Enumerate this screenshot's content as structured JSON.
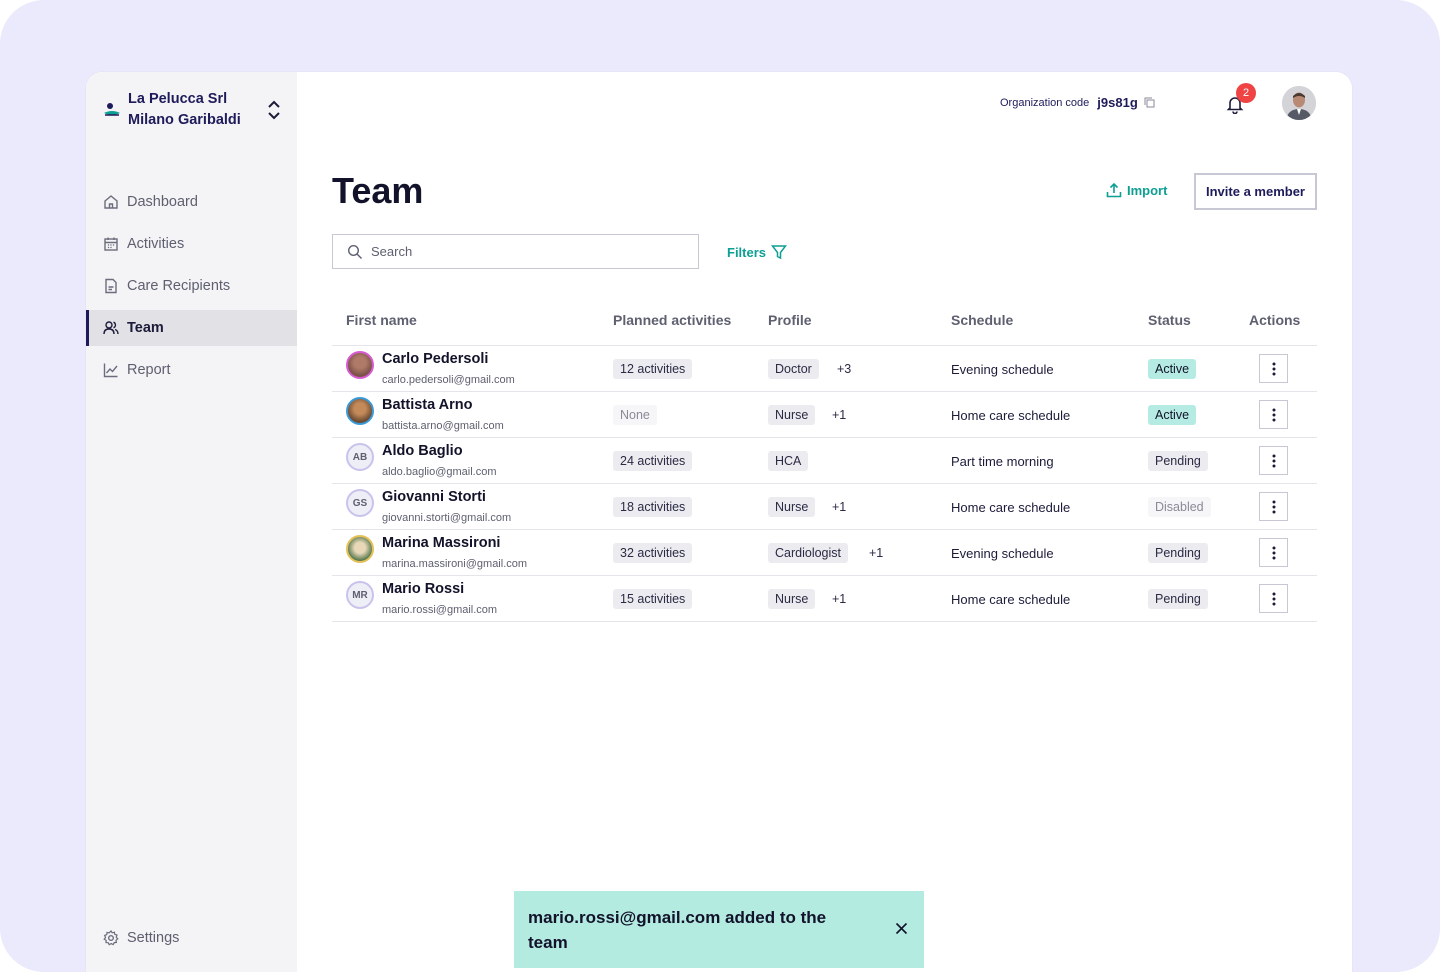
{
  "org": {
    "name_line1": "La Pelucca Srl",
    "name_line2": "Milano Garibaldi"
  },
  "sidebar": {
    "items": [
      {
        "label": "Dashboard",
        "icon": "home-icon",
        "active": false
      },
      {
        "label": "Activities",
        "icon": "calendar-icon",
        "active": false
      },
      {
        "label": "Care Recipients",
        "icon": "document-icon",
        "active": false
      },
      {
        "label": "Team",
        "icon": "users-icon",
        "active": true
      },
      {
        "label": "Report",
        "icon": "chart-line-icon",
        "active": false
      }
    ],
    "settings_label": "Settings"
  },
  "topbar": {
    "org_code_label": "Organization code",
    "org_code_value": "j9s81g",
    "notification_count": "2"
  },
  "header": {
    "title": "Team",
    "import_label": "Import",
    "invite_label": "Invite a member"
  },
  "search": {
    "placeholder": "Search"
  },
  "filters_label": "Filters",
  "table": {
    "columns": [
      "First name",
      "Planned activities",
      "Profile",
      "Schedule",
      "Status",
      "Actions"
    ],
    "rows": [
      {
        "name": "Carlo Pedersoli",
        "email": "carlo.pedersoli@gmail.com",
        "avatar": "photo",
        "activities": "12 activities",
        "profile": "Doctor",
        "profile_extra": "+3",
        "schedule": "Evening schedule",
        "status": "Active"
      },
      {
        "name": "Battista Arno",
        "email": "battista.arno@gmail.com",
        "avatar": "photo",
        "activities": "None",
        "profile": "Nurse",
        "profile_extra": "+1",
        "schedule": "Home care schedule",
        "status": "Active"
      },
      {
        "name": "Aldo Baglio",
        "email": "aldo.baglio@gmail.com",
        "avatar": "AB",
        "activities": "24 activities",
        "profile": "HCA",
        "profile_extra": "",
        "schedule": "Part time morning",
        "status": "Pending"
      },
      {
        "name": "Giovanni Storti",
        "email": "giovanni.storti@gmail.com",
        "avatar": "GS",
        "activities": "18 activities",
        "profile": "Nurse",
        "profile_extra": "+1",
        "schedule": "Home care schedule",
        "status": "Disabled"
      },
      {
        "name": "Marina Massironi",
        "email": "marina.massironi@gmail.com",
        "avatar": "photo",
        "activities": "32 activities",
        "profile": "Cardiologist",
        "profile_extra": "+1",
        "schedule": "Evening schedule",
        "status": "Pending"
      },
      {
        "name": "Mario Rossi",
        "email": "mario.rossi@gmail.com",
        "avatar": "MR",
        "activities": "15 activities",
        "profile": "Nurse",
        "profile_extra": "+1",
        "schedule": "Home care schedule",
        "status": "Pending"
      }
    ]
  },
  "toast": {
    "message": "mario.rossi@gmail.com added to the team"
  },
  "colors": {
    "accent": "#0d9e94",
    "brand": "#1e1b5a",
    "active_status": "#b5ebe2",
    "toast_bg": "#b4ebe1",
    "badge": "#f04444",
    "background": "#ebe9fc"
  }
}
